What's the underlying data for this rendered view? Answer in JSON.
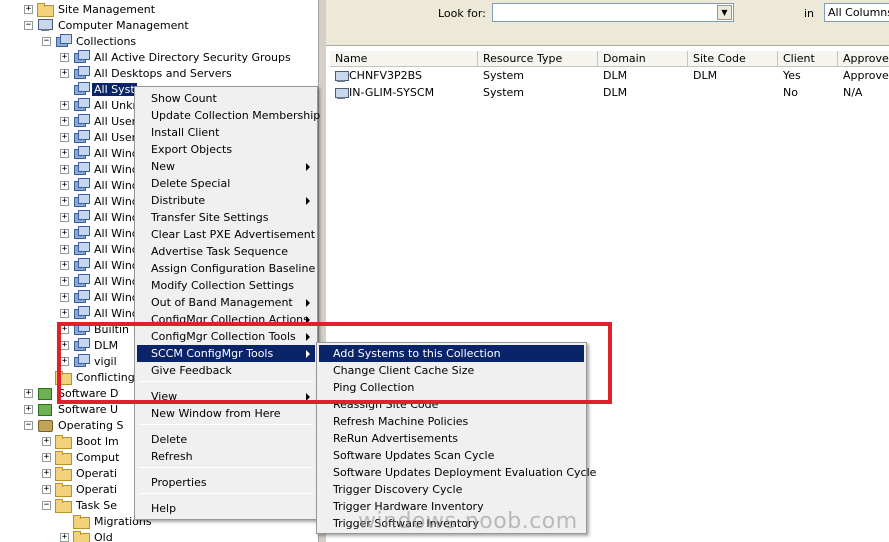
{
  "tree": {
    "items": [
      {
        "label": "Site Management",
        "toggle": "+",
        "icon": "folder-icon",
        "depth": 0
      },
      {
        "label": "Computer Management",
        "toggle": "−",
        "icon": "computer-management-icon",
        "depth": 0
      },
      {
        "label": "Collections",
        "toggle": "−",
        "icon": "collection-icon",
        "depth": 1
      },
      {
        "label": "All Active Directory Security Groups",
        "toggle": "+",
        "icon": "collection-icon",
        "depth": 2
      },
      {
        "label": "All Desktops and Servers",
        "toggle": "+",
        "icon": "collection-icon",
        "depth": 2
      },
      {
        "label": "All Syst",
        "toggle": "",
        "icon": "collection-icon",
        "depth": 2,
        "selected": true
      },
      {
        "label": "All Unkn",
        "toggle": "+",
        "icon": "collection-icon",
        "depth": 2
      },
      {
        "label": "All User",
        "toggle": "+",
        "icon": "collection-icon",
        "depth": 2
      },
      {
        "label": "All User",
        "toggle": "+",
        "icon": "collection-icon",
        "depth": 2
      },
      {
        "label": "All Wind",
        "toggle": "+",
        "icon": "collection-icon",
        "depth": 2
      },
      {
        "label": "All Wind",
        "toggle": "+",
        "icon": "collection-icon",
        "depth": 2
      },
      {
        "label": "All Wind",
        "toggle": "+",
        "icon": "collection-icon",
        "depth": 2
      },
      {
        "label": "All Wind",
        "toggle": "+",
        "icon": "collection-icon",
        "depth": 2
      },
      {
        "label": "All Wind",
        "toggle": "+",
        "icon": "collection-icon",
        "depth": 2
      },
      {
        "label": "All Wind",
        "toggle": "+",
        "icon": "collection-icon",
        "depth": 2
      },
      {
        "label": "All Wind",
        "toggle": "+",
        "icon": "collection-icon",
        "depth": 2
      },
      {
        "label": "All Wind",
        "toggle": "+",
        "icon": "collection-icon",
        "depth": 2
      },
      {
        "label": "All Wind",
        "toggle": "+",
        "icon": "collection-icon",
        "depth": 2
      },
      {
        "label": "All Wind",
        "toggle": "+",
        "icon": "collection-icon",
        "depth": 2
      },
      {
        "label": "All Wind",
        "toggle": "+",
        "icon": "collection-icon",
        "depth": 2
      },
      {
        "label": "Builtin",
        "toggle": "+",
        "icon": "collection-icon",
        "depth": 2
      },
      {
        "label": "DLM",
        "toggle": "+",
        "icon": "collection-icon",
        "depth": 2
      },
      {
        "label": "vigil",
        "toggle": "+",
        "icon": "collection-icon",
        "depth": 2
      },
      {
        "label": "Conflicting R",
        "toggle": "",
        "icon": "folder-icon",
        "depth": 1
      },
      {
        "label": "Software D",
        "toggle": "+",
        "icon": "software-icon",
        "depth": 0
      },
      {
        "label": "Software U",
        "toggle": "+",
        "icon": "software-icon",
        "depth": 0
      },
      {
        "label": "Operating S",
        "toggle": "−",
        "icon": "os-icon",
        "depth": 0
      },
      {
        "label": "Boot Im",
        "toggle": "+",
        "icon": "folder-icon",
        "depth": 1
      },
      {
        "label": "Comput",
        "toggle": "+",
        "icon": "folder-icon",
        "depth": 1
      },
      {
        "label": "Operati",
        "toggle": "+",
        "icon": "folder-icon",
        "depth": 1
      },
      {
        "label": "Operati",
        "toggle": "+",
        "icon": "folder-icon",
        "depth": 1
      },
      {
        "label": "Task Se",
        "toggle": "−",
        "icon": "folder-icon",
        "depth": 1
      },
      {
        "label": "Migrations",
        "toggle": "",
        "icon": "folder-icon",
        "depth": 2
      },
      {
        "label": "Old",
        "toggle": "+",
        "icon": "folder-icon",
        "depth": 2
      }
    ]
  },
  "search": {
    "look_for_label": "Look for:",
    "look_for_value": "",
    "in_label": "in",
    "in_value": "All Columns"
  },
  "list": {
    "columns": [
      "Name",
      "Resource Type",
      "Domain",
      "Site Code",
      "Client",
      "Approved"
    ],
    "rows": [
      [
        "CHNFV3P2BS",
        "System",
        "DLM",
        "DLM",
        "Yes",
        "Approved"
      ],
      [
        "IN-GLIM-SYSCM",
        "System",
        "DLM",
        "",
        "No",
        "N/A"
      ]
    ]
  },
  "context_menu": {
    "items": [
      {
        "label": "Show Count",
        "submenu": false
      },
      {
        "label": "Update Collection Membership",
        "submenu": false
      },
      {
        "label": "Install Client",
        "submenu": false
      },
      {
        "label": "Export Objects",
        "submenu": false
      },
      {
        "label": "New",
        "submenu": true
      },
      {
        "label": "Delete Special",
        "submenu": false
      },
      {
        "label": "Distribute",
        "submenu": true
      },
      {
        "label": "Transfer Site Settings",
        "submenu": false
      },
      {
        "label": "Clear Last PXE Advertisement",
        "submenu": false
      },
      {
        "label": "Advertise Task Sequence",
        "submenu": false
      },
      {
        "label": "Assign Configuration Baseline",
        "submenu": false
      },
      {
        "label": "Modify Collection Settings",
        "submenu": false
      },
      {
        "label": "Out of Band Management",
        "submenu": true
      },
      {
        "label": "ConfigMgr Collection Actions",
        "submenu": true
      },
      {
        "label": "ConfigMgr Collection Tools",
        "submenu": true
      },
      {
        "label": "SCCM ConfigMgr Tools",
        "submenu": true,
        "highlighted": true
      },
      {
        "label": "Give Feedback",
        "submenu": false
      },
      {
        "label": "View",
        "submenu": true
      },
      {
        "label": "New Window from Here",
        "submenu": false
      },
      {
        "label": "Delete",
        "submenu": false
      },
      {
        "label": "Refresh",
        "submenu": false
      },
      {
        "label": "Properties",
        "submenu": false
      },
      {
        "label": "Help",
        "submenu": false
      }
    ]
  },
  "submenu": {
    "items": [
      {
        "label": "Add Systems to this Collection",
        "highlighted": true
      },
      {
        "label": "Change Client Cache Size"
      },
      {
        "label": "Ping Collection"
      },
      {
        "label": "Reassign Site Code"
      },
      {
        "label": "Refresh Machine Policies"
      },
      {
        "label": "ReRun Advertisements"
      },
      {
        "label": "Software Updates Scan Cycle"
      },
      {
        "label": "Software Updates Deployment Evaluation Cycle"
      },
      {
        "label": "Trigger Discovery Cycle"
      },
      {
        "label": "Trigger Hardware Inventory"
      },
      {
        "label": "Trigger Software Inventory"
      }
    ]
  },
  "watermark": "windows-noob.com",
  "colors": {
    "highlight": "#0a246a",
    "annotation_box": "#e0202a"
  }
}
